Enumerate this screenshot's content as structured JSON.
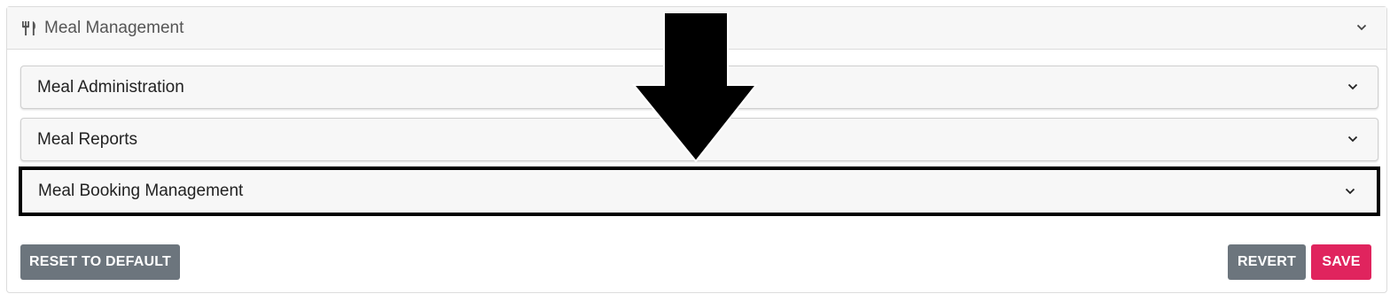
{
  "panel": {
    "title": "Meal Management",
    "icon": "utensils-icon",
    "expand_icon": "chevron-down-icon"
  },
  "accordion": {
    "items": [
      {
        "label": "Meal Administration",
        "icon": "chevron-down-icon"
      },
      {
        "label": "Meal Reports",
        "icon": "chevron-down-icon"
      },
      {
        "label": "Meal Booking Management",
        "icon": "chevron-down-icon",
        "highlighted": true
      }
    ]
  },
  "footer": {
    "reset_label": "RESET TO DEFAULT",
    "revert_label": "REVERT",
    "save_label": "SAVE"
  },
  "annotation": {
    "icon": "down-arrow-icon",
    "color": "#000000"
  },
  "colors": {
    "secondary_button": "#6c757d",
    "save_button": "#e0245e",
    "header_background": "#f7f7f7"
  }
}
